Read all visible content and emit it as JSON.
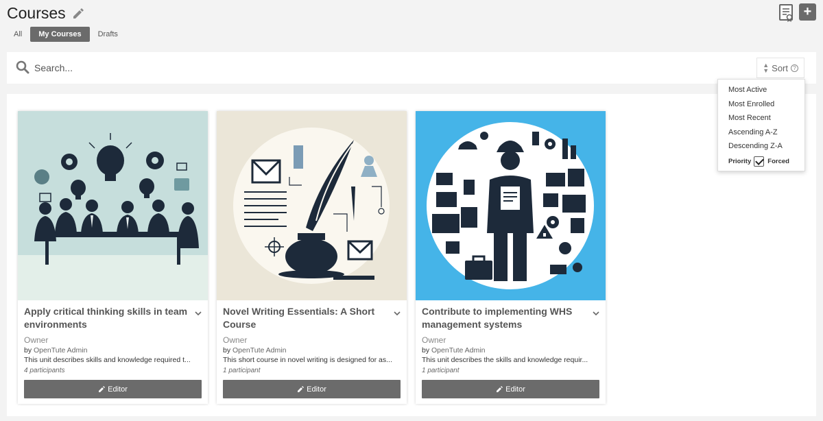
{
  "header": {
    "title": "Courses",
    "edit_icon": "pencil-icon",
    "certificate_icon": "certificate-icon",
    "add_label": "+"
  },
  "tabs": [
    {
      "label": "All",
      "active": false
    },
    {
      "label": "My Courses",
      "active": true
    },
    {
      "label": "Drafts",
      "active": false
    }
  ],
  "search": {
    "placeholder": "Search...",
    "value": ""
  },
  "sort": {
    "label": "Sort",
    "help": "?",
    "options": [
      "Most Active",
      "Most Enrolled",
      "Most Recent",
      "Ascending A-Z",
      "Descending Z-A"
    ],
    "priority_label": "Priority",
    "forced_label": "Forced",
    "forced_checked": true
  },
  "courses": [
    {
      "title": "Apply critical thinking skills in team environments",
      "role": "Owner",
      "by_prefix": "by",
      "author": "OpenTute Admin",
      "description": "This unit describes skills and knowledge required t...",
      "participants": "4 participants",
      "editor_label": "Editor",
      "image": "team-meeting-lightbulbs-illustration",
      "image_bg": "#c5dcdb"
    },
    {
      "title": "Novel Writing Essentials: A Short Course",
      "role": "Owner",
      "by_prefix": "by",
      "author": "OpenTute Admin",
      "description": "This short course in novel writing is designed for as...",
      "participants": "1 participant",
      "editor_label": "Editor",
      "image": "quill-and-inkwell-illustration",
      "image_bg": "#ece7d9"
    },
    {
      "title": "Contribute to implementing WHS management systems",
      "role": "Owner",
      "by_prefix": "by",
      "author": "OpenTute Admin",
      "description": "This unit describes the skills and knowledge requir...",
      "participants": "1 participant",
      "editor_label": "Editor",
      "image": "safety-worker-industrial-icons-illustration",
      "image_bg": "#43b3e8"
    }
  ],
  "colors": {
    "button_gray": "#6b6b6b",
    "page_bg": "#f3f3f3",
    "navy_ink": "#1d2a3a"
  }
}
